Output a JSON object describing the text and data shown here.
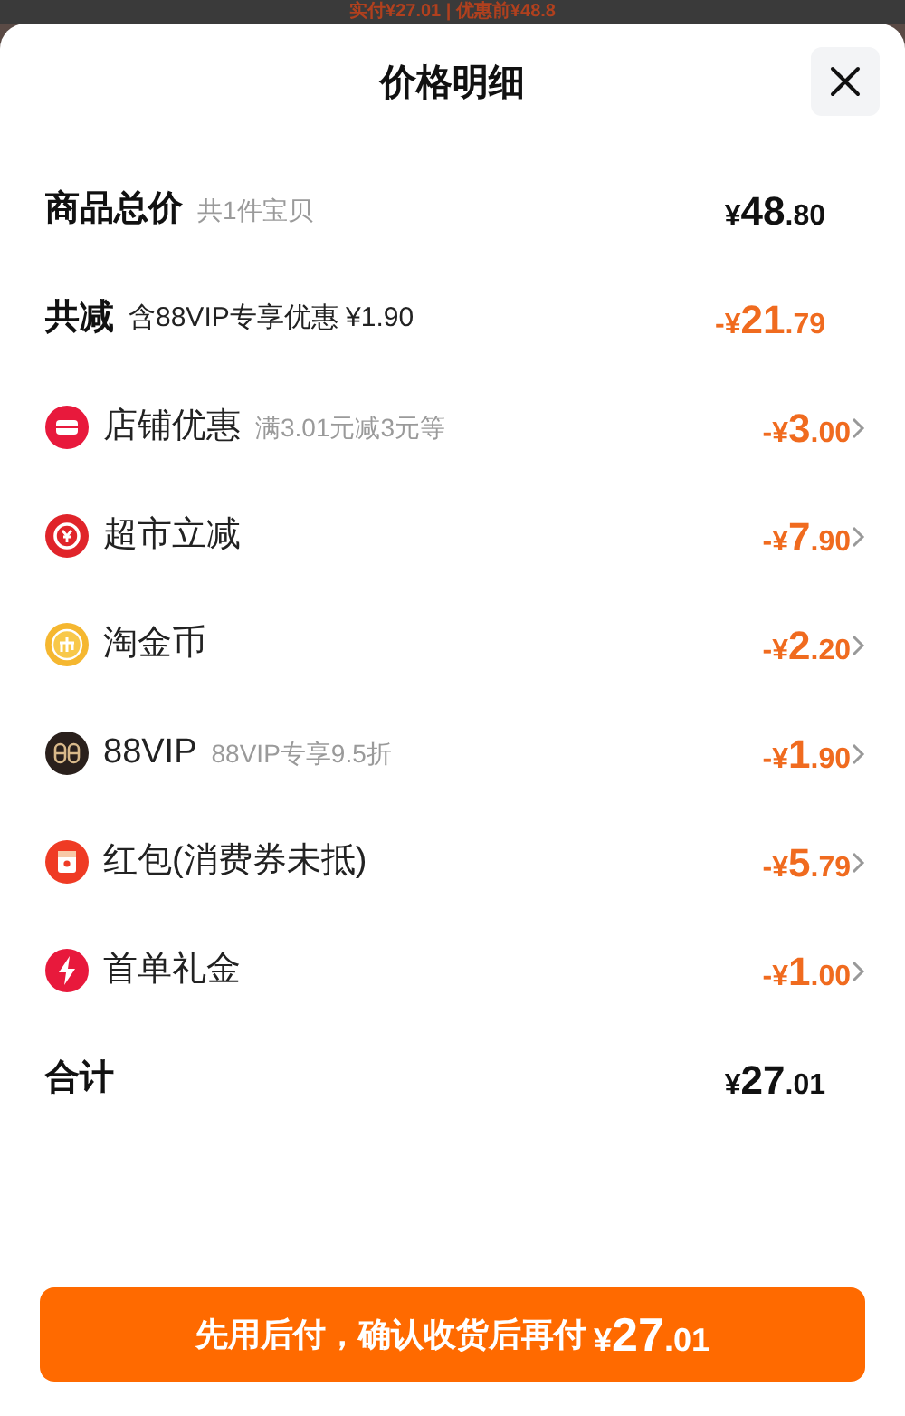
{
  "backdrop": {
    "text": "实付¥27.01 | 优惠前¥48.8"
  },
  "sheet": {
    "title": "价格明细"
  },
  "rows": [
    {
      "kind": "subtotal",
      "label": "商品总价",
      "note": "共1件宝贝",
      "amount": {
        "prefix": "¥",
        "integer": "48",
        "decimal": ".80"
      }
    },
    {
      "kind": "saving",
      "label": "共减",
      "note": "含88VIP专享优惠 ¥1.90",
      "amount": {
        "prefix": "-¥",
        "integer": "21",
        "decimal": ".79"
      }
    },
    {
      "kind": "shop",
      "label": "店铺优惠",
      "note": "满3.01元减3元等",
      "amount": {
        "prefix": "-¥",
        "integer": "3",
        "decimal": ".00"
      }
    },
    {
      "kind": "market",
      "label": "超市立减",
      "amount": {
        "prefix": "-¥",
        "integer": "7",
        "decimal": ".90"
      }
    },
    {
      "kind": "coin",
      "label": "淘金币",
      "amount": {
        "prefix": "-¥",
        "integer": "2",
        "decimal": ".20"
      }
    },
    {
      "kind": "vip",
      "label": "88VIP",
      "note": "88VIP专享9.5折",
      "amount": {
        "prefix": "-¥",
        "integer": "1",
        "decimal": ".90"
      }
    },
    {
      "kind": "packet",
      "label": "红包(消费券未抵)",
      "amount": {
        "prefix": "-¥",
        "integer": "5",
        "decimal": ".79"
      }
    },
    {
      "kind": "gift",
      "label": "首单礼金",
      "amount": {
        "prefix": "-¥",
        "integer": "1",
        "decimal": ".00"
      }
    },
    {
      "kind": "total",
      "label": "合计",
      "amount": {
        "prefix": "¥",
        "integer": "27",
        "decimal": ".01"
      }
    }
  ],
  "button": {
    "label": "先用后付，确认收货后再付",
    "amount": {
      "prefix": "¥",
      "integer": "27",
      "decimal": ".01"
    }
  }
}
